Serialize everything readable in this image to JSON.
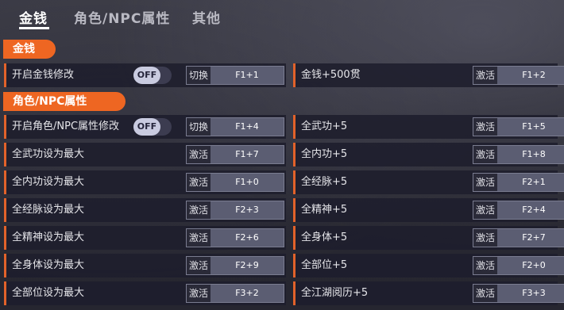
{
  "tabs": [
    {
      "label": "金钱"
    },
    {
      "label": "角色/NPC属性"
    },
    {
      "label": "其他"
    }
  ],
  "sections": {
    "money": {
      "title": "金钱"
    },
    "attrs": {
      "title": "角色/NPC属性"
    }
  },
  "toggle_off": "OFF",
  "rows": [
    {
      "label": "开启金钱修改",
      "action": "切换",
      "key": "F1+1"
    },
    {
      "label": "金钱+500贯",
      "action": "激活",
      "key": "F1+2"
    },
    {
      "label": "开启角色/NPC属性修改",
      "action": "切换",
      "key": "F1+4"
    },
    {
      "label": "全武功+5",
      "action": "激活",
      "key": "F1+5"
    },
    {
      "label": "全武功设为最大",
      "action": "激活",
      "key": "F1+7"
    },
    {
      "label": "全内功+5",
      "action": "激活",
      "key": "F1+8"
    },
    {
      "label": "全内功设为最大",
      "action": "激活",
      "key": "F1+0"
    },
    {
      "label": "全经脉+5",
      "action": "激活",
      "key": "F2+1"
    },
    {
      "label": "全经脉设为最大",
      "action": "激活",
      "key": "F2+3"
    },
    {
      "label": "全精神+5",
      "action": "激活",
      "key": "F2+4"
    },
    {
      "label": "全精神设为最大",
      "action": "激活",
      "key": "F2+6"
    },
    {
      "label": "全身体+5",
      "action": "激活",
      "key": "F2+7"
    },
    {
      "label": "全身体设为最大",
      "action": "激活",
      "key": "F2+9"
    },
    {
      "label": "全部位+5",
      "action": "激活",
      "key": "F2+0"
    },
    {
      "label": "全部位设为最大",
      "action": "激活",
      "key": "F3+2"
    },
    {
      "label": "全江湖阅历+5",
      "action": "激活",
      "key": "F3+3"
    }
  ]
}
